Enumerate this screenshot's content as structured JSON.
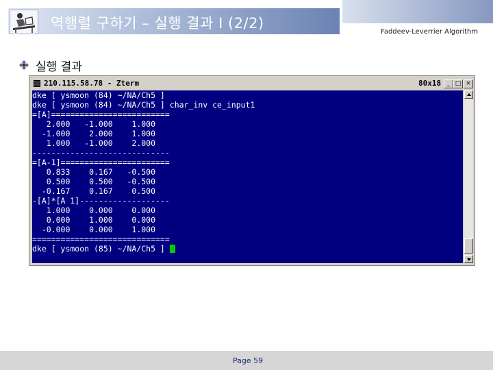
{
  "header": {
    "title": "역행렬 구하기 – 실행 결과 I (2/2)",
    "subtitle": "Faddeev-Leverrier Algorithm"
  },
  "bullet": {
    "text": "실행 결과",
    "icon": "flower-bullet-icon"
  },
  "terminal": {
    "title": "210.115.58.78 - Zterm",
    "size": "80x18",
    "buttons": [
      "_",
      "□",
      "×"
    ],
    "background": "#000080",
    "lines": [
      "dke [ ysmoon (84) ~/NA/Ch5 ]",
      "dke [ ysmoon (84) ~/NA/Ch5 ] char_inv ce_input1",
      "=[A]=========================",
      "   2.000   -1.000    1.000",
      "  -1.000    2.000    1.000",
      "   1.000   -1.000    2.000",
      "-----------------------------",
      "=[A-1]=======================",
      "   0.833    0.167   -0.500",
      "   0.500    0.500   -0.500",
      "  -0.167    0.167    0.500",
      "-[A]*[A 1]-------------------",
      "   1.000    0.000    0.000",
      "   0.000    1.000    0.000",
      "  -0.000    0.000    1.000",
      "=============================",
      "dke [ ysmoon (85) ~/NA/Ch5 ] "
    ]
  },
  "footer": {
    "page": "Page 59"
  }
}
